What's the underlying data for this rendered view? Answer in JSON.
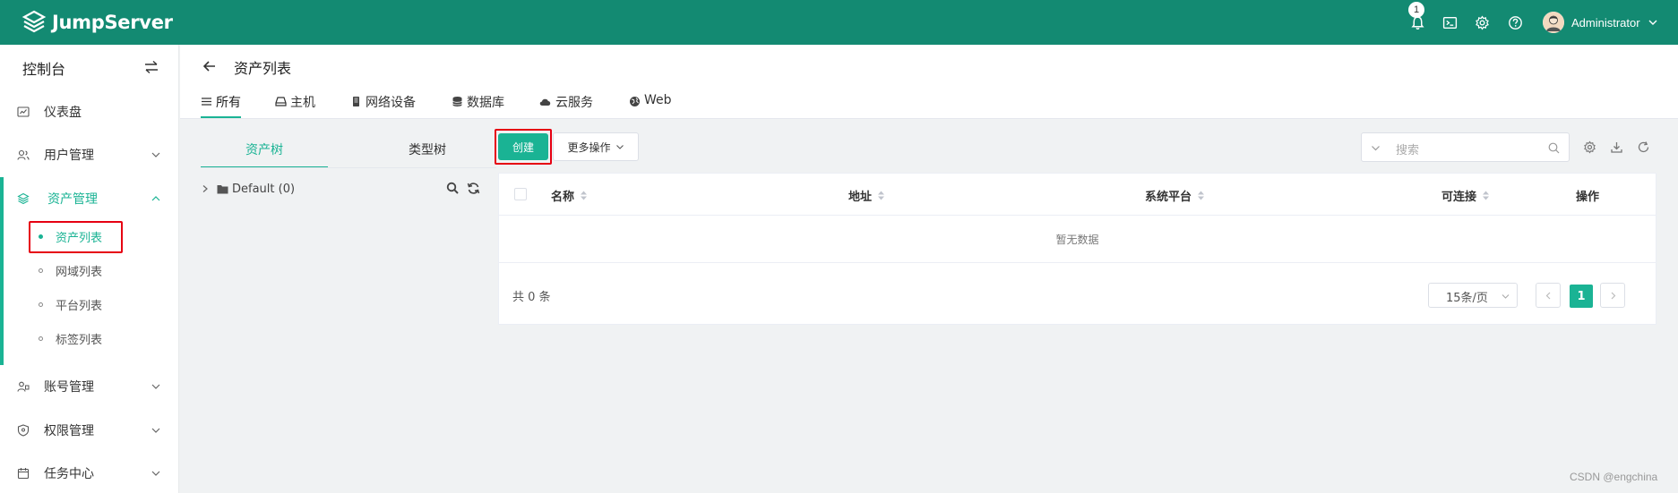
{
  "header": {
    "logo_text": "JumpServer",
    "notification_count": "1",
    "username": "Administrator",
    "icons": [
      "bell-icon",
      "terminal-icon",
      "settings-icon",
      "help-icon"
    ]
  },
  "sidebar": {
    "console_label": "控制台",
    "items": [
      {
        "label": "仪表盘",
        "icon": "dashboard-icon"
      },
      {
        "label": "用户管理",
        "icon": "users-icon"
      },
      {
        "label": "资产管理",
        "icon": "assets-icon",
        "active": true
      },
      {
        "label": "账号管理",
        "icon": "accounts-icon"
      },
      {
        "label": "权限管理",
        "icon": "shield-icon"
      },
      {
        "label": "任务中心",
        "icon": "calendar-icon"
      }
    ],
    "sub_items": [
      {
        "label": "资产列表",
        "active": true
      },
      {
        "label": "网域列表"
      },
      {
        "label": "平台列表"
      },
      {
        "label": "标签列表"
      }
    ]
  },
  "page": {
    "title": "资产列表",
    "tabs": [
      {
        "label": "所有",
        "icon": "list-icon",
        "active": true
      },
      {
        "label": "主机",
        "icon": "host-icon"
      },
      {
        "label": "网络设备",
        "icon": "device-icon"
      },
      {
        "label": "数据库",
        "icon": "database-icon"
      },
      {
        "label": "云服务",
        "icon": "cloud-icon"
      },
      {
        "label": "Web",
        "icon": "globe-icon"
      }
    ]
  },
  "tree": {
    "tabs": [
      "资产树",
      "类型树"
    ],
    "node_label": "Default (0)"
  },
  "toolbar": {
    "create_label": "创建",
    "more_label": "更多操作",
    "search_placeholder": "搜索"
  },
  "table": {
    "columns": [
      "名称",
      "地址",
      "系统平台",
      "可连接",
      "操作"
    ],
    "empty_text": "暂无数据",
    "total_text": "共 0 条",
    "page_size": "15条/页",
    "current_page": "1"
  },
  "watermark": "CSDN @engchina",
  "colors": {
    "header_bg": "#138a72",
    "accent": "#1ab394",
    "highlight_box": "#e60012"
  }
}
